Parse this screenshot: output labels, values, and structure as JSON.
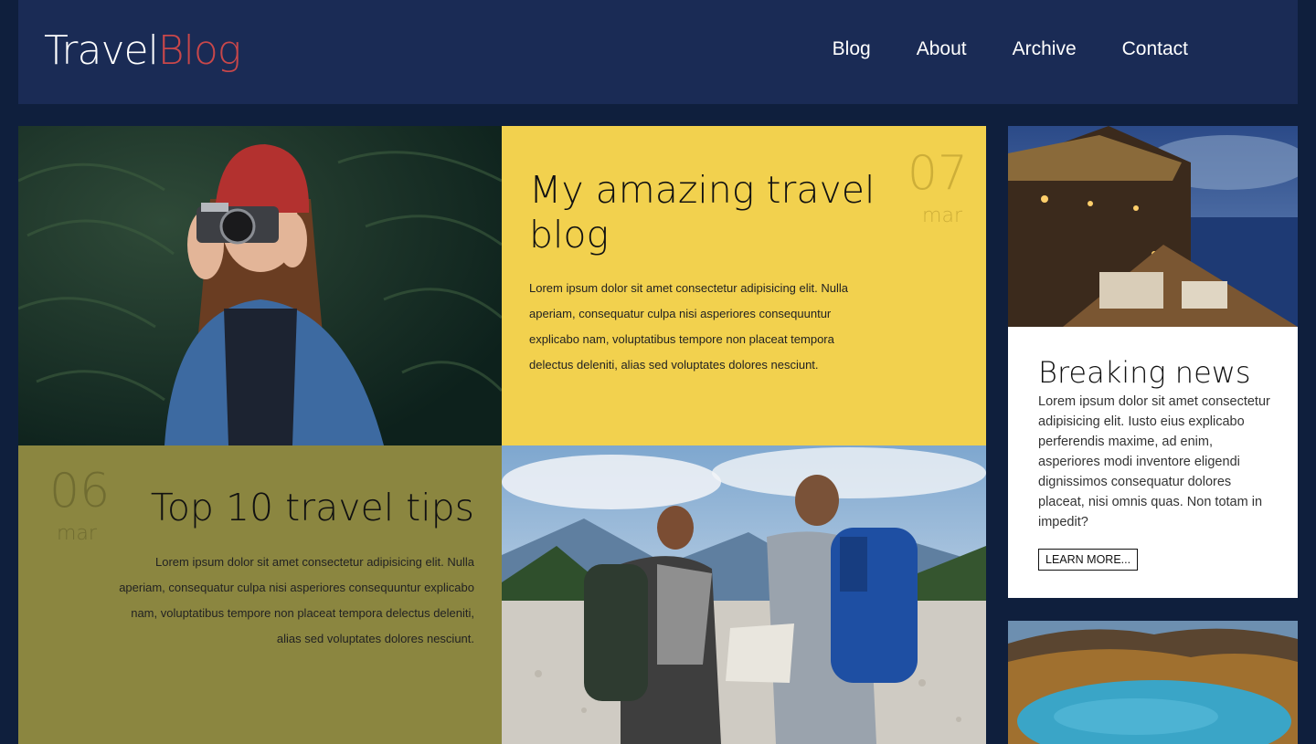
{
  "header": {
    "logo_part1": "Travel",
    "logo_part2": "Blog",
    "nav": [
      "Blog",
      "About",
      "Archive",
      "Contact"
    ]
  },
  "posts": [
    {
      "title": "My amazing travel blog",
      "text": "Lorem ipsum dolor sit amet consectetur adipisicing elit. Nulla aperiam, consequatur culpa nisi asperiores consequuntur explicabo nam, voluptatibus tempore non placeat tempora delectus deleniti, alias sed voluptates dolores nesciunt.",
      "day": "07",
      "month": "mar"
    },
    {
      "title": "Top 10 travel tips",
      "text": "Lorem ipsum dolor sit amet consectetur adipisicing elit. Nulla aperiam, consequatur culpa nisi asperiores consequuntur explicabo nam, voluptatibus tempore non placeat tempora delectus deleniti, alias sed voluptates dolores nesciunt.",
      "day": "06",
      "month": "mar"
    }
  ],
  "breaking": {
    "title": "Breaking news",
    "text": "Lorem ipsum dolor sit amet consectetur adipisicing elit. Iusto eius explicabo perferendis maxime, ad enim, asperiores modi inventore eligendi dignissimos consequatur dolores placeat, nisi omnis quas. Non totam in impedit?",
    "button": "LEARN MORE..."
  },
  "colors": {
    "page_bg": "#0f1f3d",
    "header_bg": "#1a2b55",
    "accent_red": "#c8474a",
    "yellow": "#f2d14e",
    "olive": "#8b8640"
  }
}
